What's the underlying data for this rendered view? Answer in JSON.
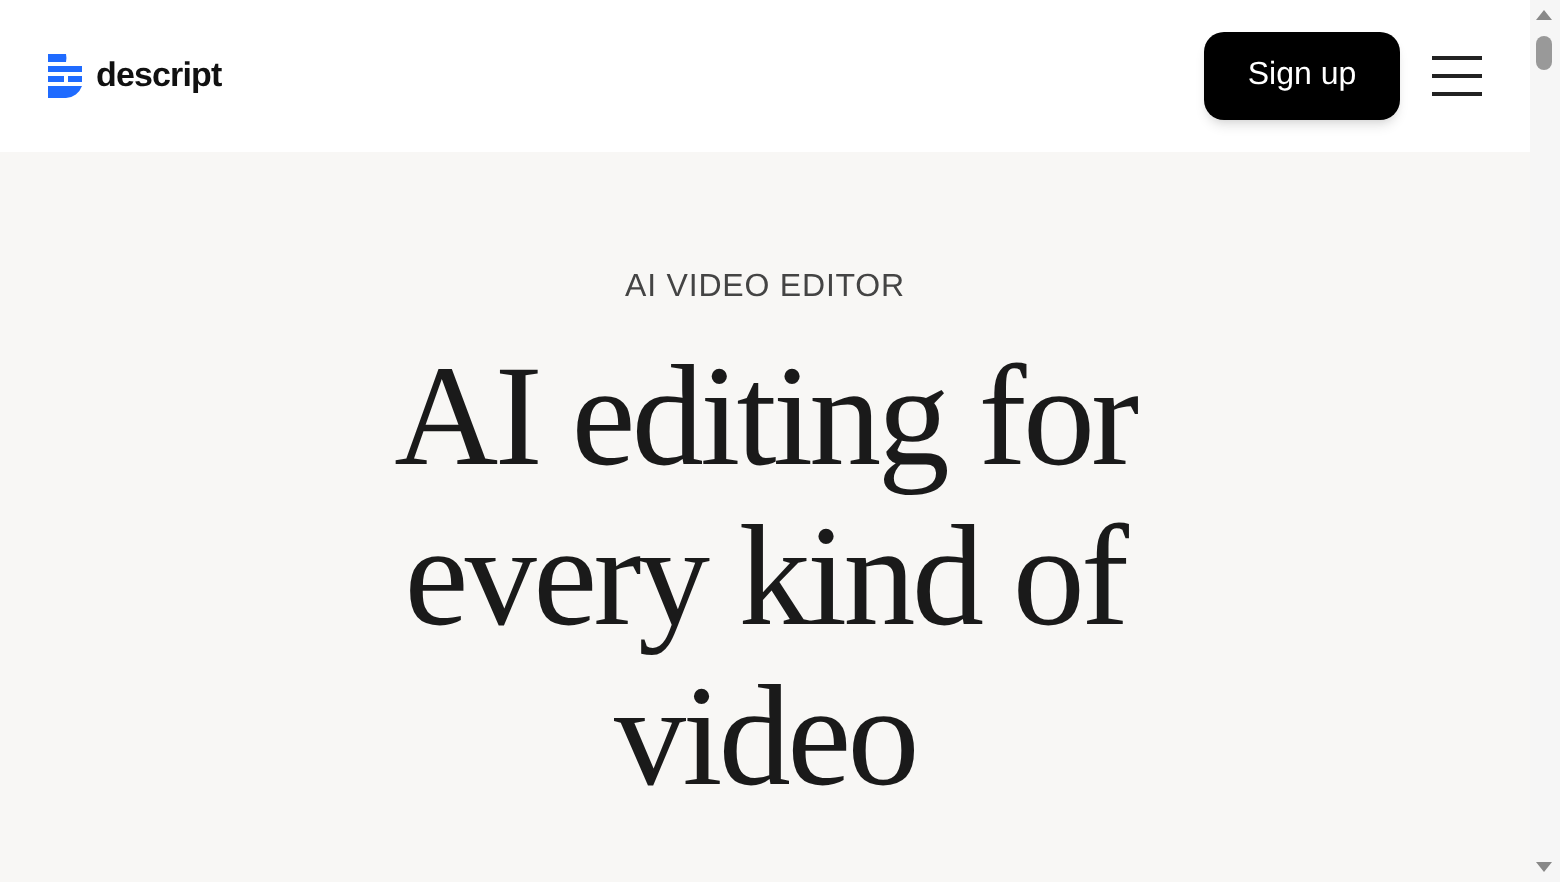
{
  "header": {
    "logo_text": "descript",
    "signup_button": "Sign up"
  },
  "hero": {
    "eyebrow": "AI VIDEO EDITOR",
    "headline": "AI editing for every kind of video"
  }
}
